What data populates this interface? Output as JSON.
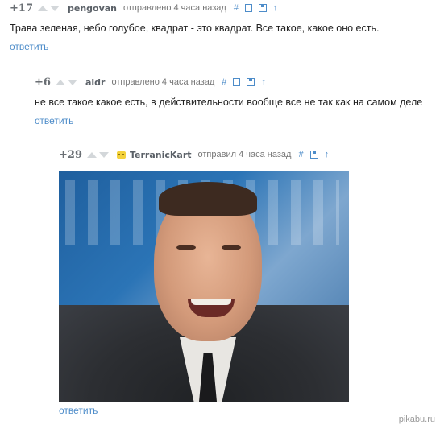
{
  "comments": [
    {
      "rating": "+17",
      "author": "pengovan",
      "sent": "отправлено 4 часа назад",
      "text": "Трава зеленая, небо голубое, квадрат - это квадрат. Все такое, какое оно есть.",
      "reply": "ответить"
    },
    {
      "rating": "+6",
      "author": "aldr",
      "sent": "отправлено 4 часа назад",
      "text": "не все такое какое есть, в действительности вообще все не так как на самом деле",
      "reply": "ответить"
    },
    {
      "rating": "+29",
      "author": "TerranicKart",
      "sent": "отправил 4 часа назад",
      "reply": "ответить"
    }
  ],
  "tools": {
    "hash": "#",
    "arrow": "↑"
  },
  "watermark": "pikabu.ru",
  "colors": {
    "link": "#4d8cc9",
    "rating": "#6a6f74",
    "vote_arrow": "#d3d7da"
  }
}
